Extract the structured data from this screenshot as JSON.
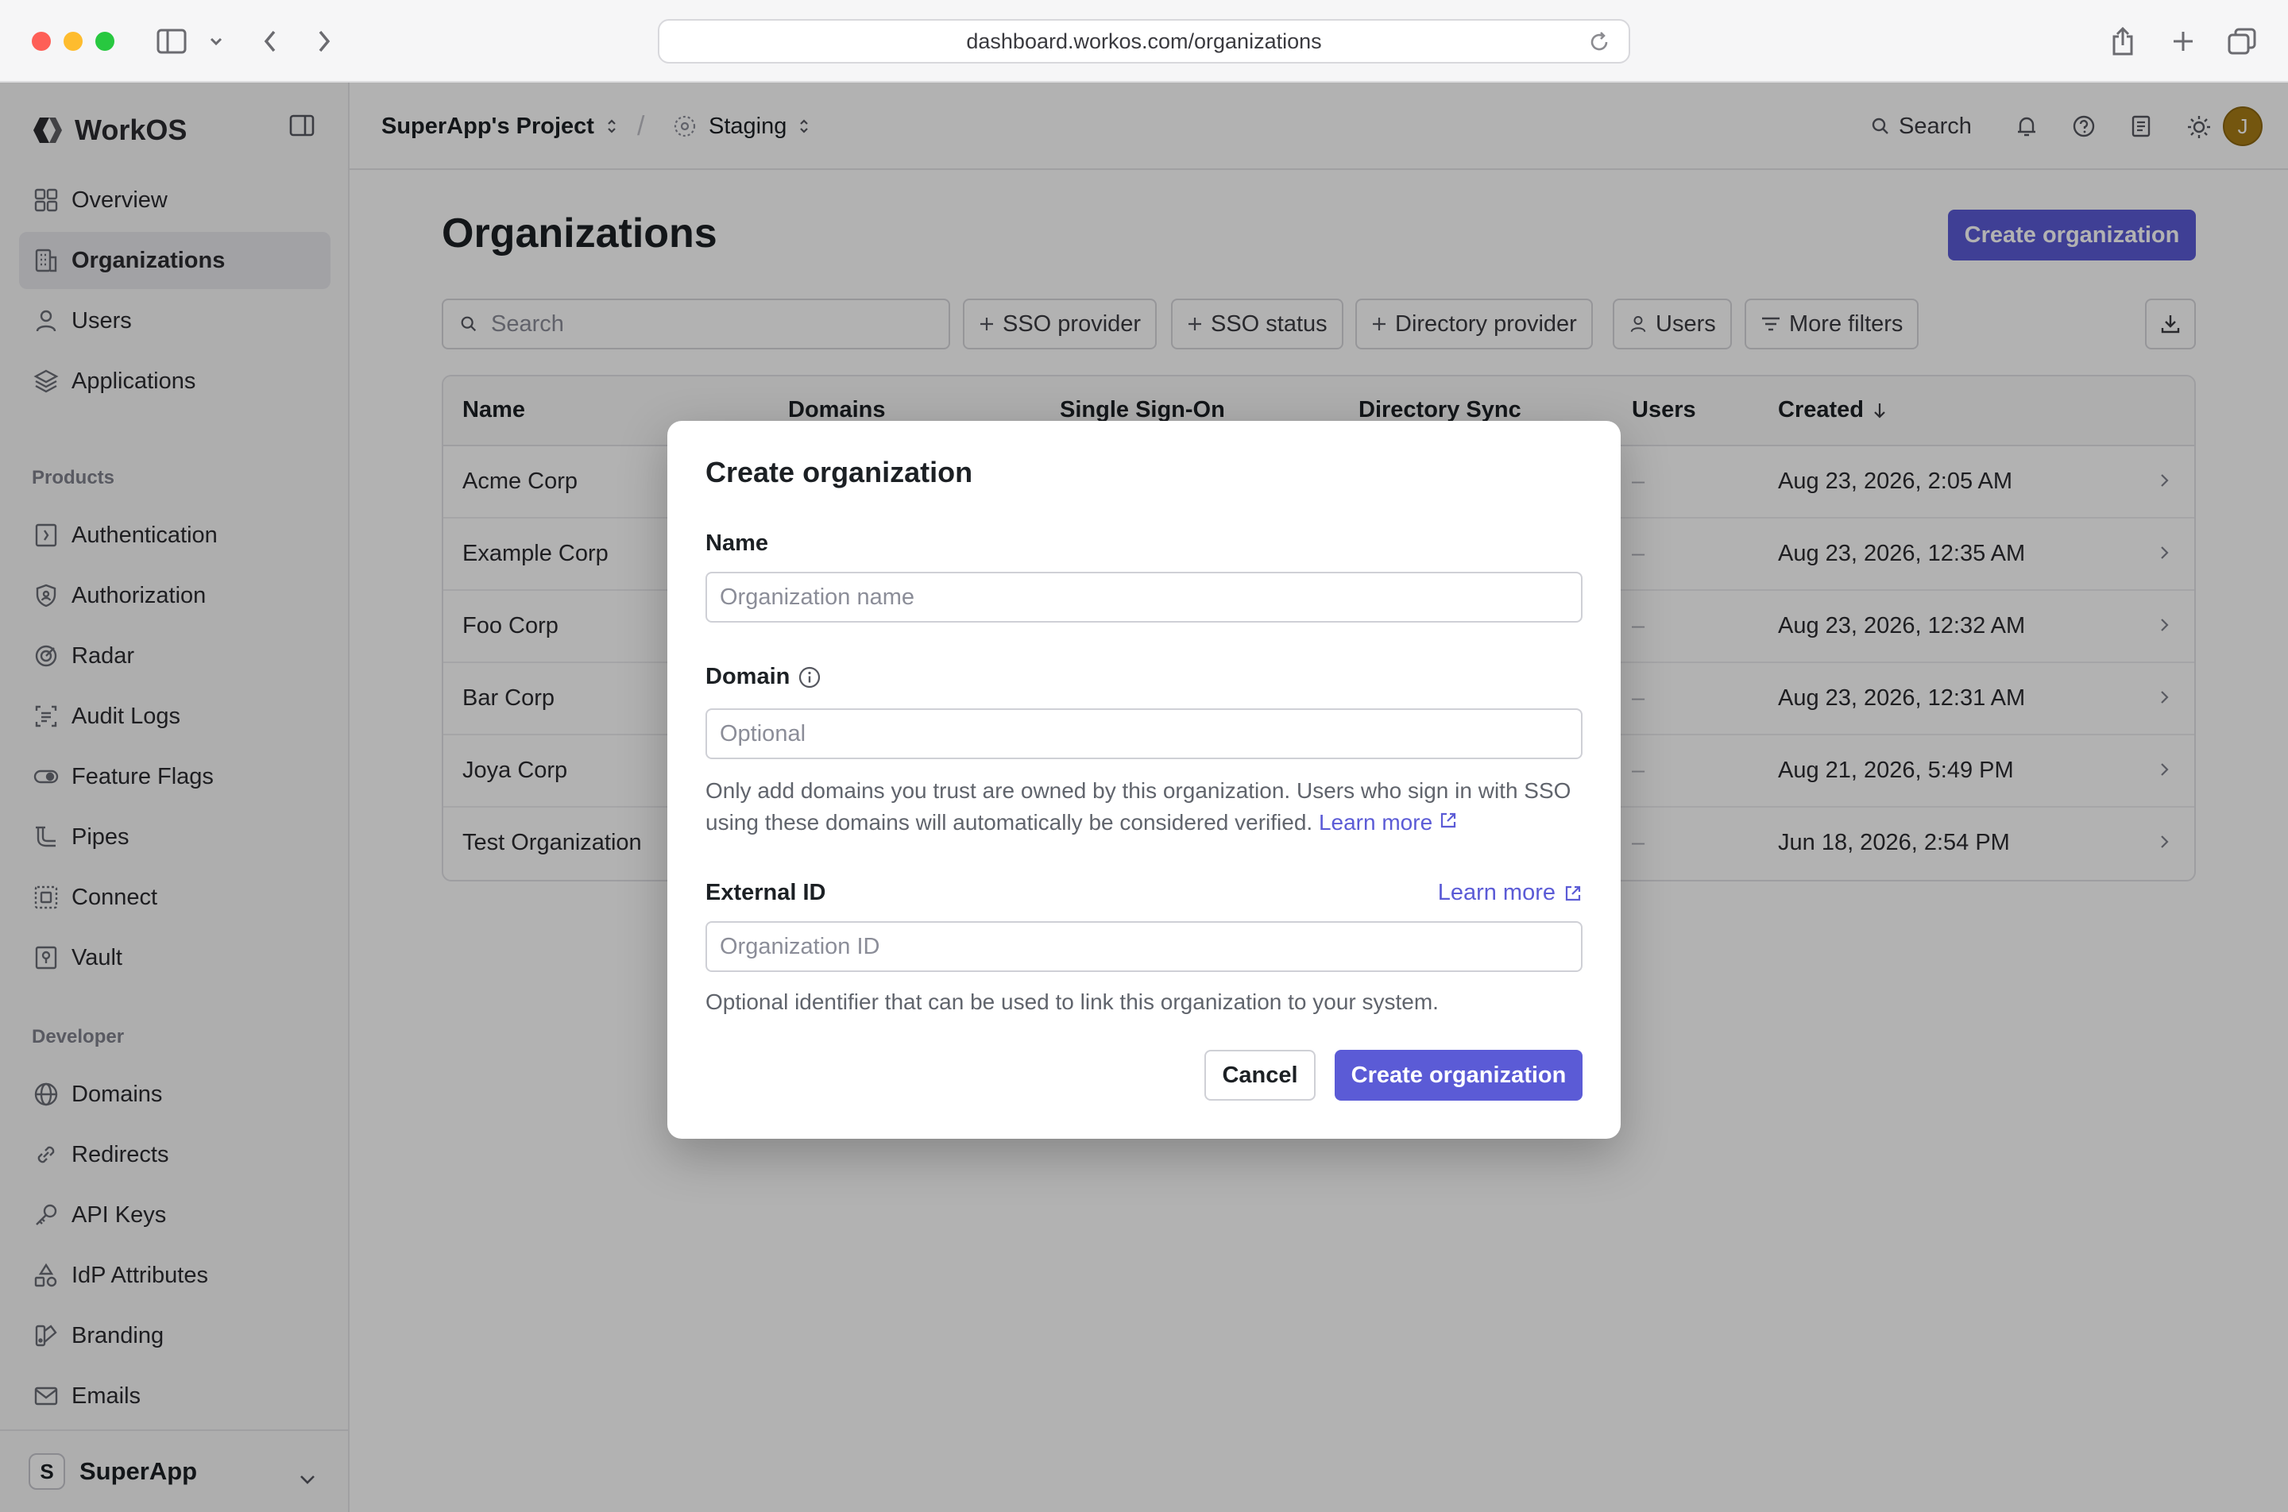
{
  "browser": {
    "url": "dashboard.workos.com/organizations"
  },
  "sidebar": {
    "brand": "WorkOS",
    "main_items": [
      {
        "label": "Overview",
        "icon": "grid-icon"
      },
      {
        "label": "Organizations",
        "icon": "building-icon",
        "active": true
      },
      {
        "label": "Users",
        "icon": "user-icon"
      },
      {
        "label": "Applications",
        "icon": "layers-icon"
      }
    ],
    "products_heading": "Products",
    "product_items": [
      {
        "label": "Authentication",
        "icon": "door-icon"
      },
      {
        "label": "Authorization",
        "icon": "shield-icon"
      },
      {
        "label": "Radar",
        "icon": "radar-icon"
      },
      {
        "label": "Audit Logs",
        "icon": "audit-icon"
      },
      {
        "label": "Feature Flags",
        "icon": "toggle-icon"
      },
      {
        "label": "Pipes",
        "icon": "pipes-icon"
      },
      {
        "label": "Connect",
        "icon": "connect-icon"
      },
      {
        "label": "Vault",
        "icon": "vault-icon"
      }
    ],
    "developer_heading": "Developer",
    "developer_items": [
      {
        "label": "Domains",
        "icon": "globe-icon"
      },
      {
        "label": "Redirects",
        "icon": "link-icon"
      },
      {
        "label": "API Keys",
        "icon": "key-icon"
      },
      {
        "label": "IdP Attributes",
        "icon": "shapes-icon"
      },
      {
        "label": "Branding",
        "icon": "palette-icon"
      },
      {
        "label": "Emails",
        "icon": "mail-icon"
      }
    ],
    "workspace": {
      "initial": "S",
      "name": "SuperApp"
    }
  },
  "topbar": {
    "project": "SuperApp's Project",
    "separator": "/",
    "environment": "Staging",
    "search_label": "Search",
    "avatar_initial": "J"
  },
  "main": {
    "title": "Organizations",
    "create_button": "Create organization",
    "search_placeholder": "Search",
    "filters": [
      "SSO provider",
      "SSO status",
      "Directory provider",
      "Users",
      "More filters"
    ],
    "table": {
      "columns": [
        "Name",
        "Domains",
        "Single Sign-On",
        "Directory Sync",
        "Users",
        "Created"
      ],
      "rows": [
        {
          "name": "Acme Corp",
          "users": "–",
          "created": "Aug 23, 2026, 2:05 AM"
        },
        {
          "name": "Example Corp",
          "users": "–",
          "created": "Aug 23, 2026, 12:35 AM"
        },
        {
          "name": "Foo Corp",
          "users": "–",
          "created": "Aug 23, 2026, 12:32 AM"
        },
        {
          "name": "Bar Corp",
          "users": "–",
          "created": "Aug 23, 2026, 12:31 AM"
        },
        {
          "name": "Joya Corp",
          "users": "–",
          "created": "Aug 21, 2026, 5:49 PM"
        },
        {
          "name": "Test Organization",
          "users": "–",
          "created": "Jun 18, 2026, 2:54 PM"
        }
      ]
    }
  },
  "modal": {
    "title": "Create organization",
    "name_label": "Name",
    "name_placeholder": "Organization name",
    "domain_label": "Domain",
    "domain_placeholder": "Optional",
    "domain_help": "Only add domains you trust are owned by this organization. Users who sign in with SSO using these domains will automatically be considered verified.",
    "learn_more": "Learn more",
    "external_id_label": "External ID",
    "external_id_placeholder": "Organization ID",
    "external_id_help": "Optional identifier that can be used to link this organization to your system.",
    "cancel": "Cancel",
    "submit": "Create organization"
  },
  "colors": {
    "accent": "#5b5bd6",
    "overlay": "rgba(0,0,0,0.30)"
  }
}
